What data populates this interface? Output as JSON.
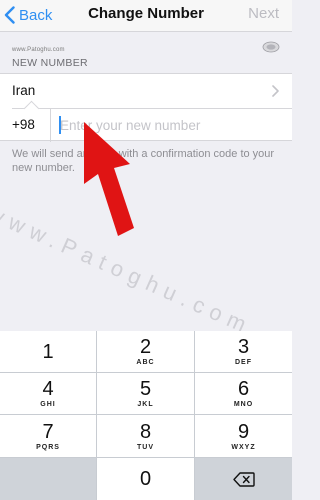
{
  "navbar": {
    "back_label": "Back",
    "title": "Change Number",
    "next_label": "Next"
  },
  "watermark": {
    "small": "www.Patoghu.com",
    "diagonal": "www.Patoghu.com"
  },
  "section": {
    "header": "NEW NUMBER"
  },
  "country": {
    "name": "Iran"
  },
  "phone": {
    "code": "+98",
    "placeholder": "Enter your new number",
    "value": ""
  },
  "info_text": "We will send an SMS with a confirmation code to your new number.",
  "keyboard": {
    "keys": [
      {
        "num": "1",
        "letters": ""
      },
      {
        "num": "2",
        "letters": "ABC"
      },
      {
        "num": "3",
        "letters": "DEF"
      },
      {
        "num": "4",
        "letters": "GHI"
      },
      {
        "num": "5",
        "letters": "JKL"
      },
      {
        "num": "6",
        "letters": "MNO"
      },
      {
        "num": "7",
        "letters": "PQRS"
      },
      {
        "num": "8",
        "letters": "TUV"
      },
      {
        "num": "9",
        "letters": "WXYZ"
      },
      {
        "num": "0",
        "letters": ""
      }
    ]
  },
  "colors": {
    "accent": "#2f8ff2",
    "arrow": "#e01414",
    "background": "#efeff4"
  },
  "icons": {
    "back": "chevron-left-icon",
    "disclosure": "chevron-right-icon",
    "delete": "backspace-icon",
    "pointer": "red-arrow-icon"
  }
}
